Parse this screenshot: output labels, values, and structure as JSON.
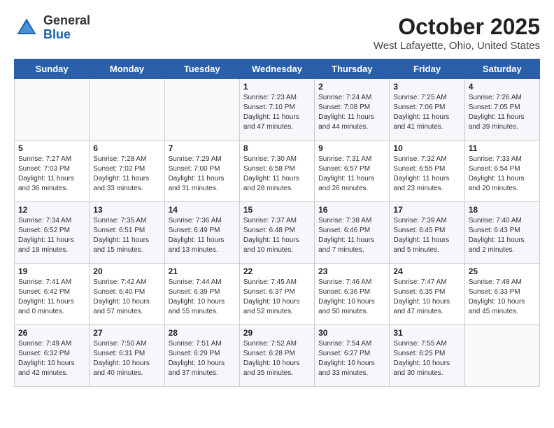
{
  "header": {
    "logo": {
      "general": "General",
      "blue": "Blue"
    },
    "title": "October 2025",
    "location": "West Lafayette, Ohio, United States"
  },
  "weekdays": [
    "Sunday",
    "Monday",
    "Tuesday",
    "Wednesday",
    "Thursday",
    "Friday",
    "Saturday"
  ],
  "weeks": [
    [
      {
        "day": "",
        "sunrise": "",
        "sunset": "",
        "daylight": ""
      },
      {
        "day": "",
        "sunrise": "",
        "sunset": "",
        "daylight": ""
      },
      {
        "day": "",
        "sunrise": "",
        "sunset": "",
        "daylight": ""
      },
      {
        "day": "1",
        "sunrise": "Sunrise: 7:23 AM",
        "sunset": "Sunset: 7:10 PM",
        "daylight": "Daylight: 11 hours and 47 minutes."
      },
      {
        "day": "2",
        "sunrise": "Sunrise: 7:24 AM",
        "sunset": "Sunset: 7:08 PM",
        "daylight": "Daylight: 11 hours and 44 minutes."
      },
      {
        "day": "3",
        "sunrise": "Sunrise: 7:25 AM",
        "sunset": "Sunset: 7:06 PM",
        "daylight": "Daylight: 11 hours and 41 minutes."
      },
      {
        "day": "4",
        "sunrise": "Sunrise: 7:26 AM",
        "sunset": "Sunset: 7:05 PM",
        "daylight": "Daylight: 11 hours and 39 minutes."
      }
    ],
    [
      {
        "day": "5",
        "sunrise": "Sunrise: 7:27 AM",
        "sunset": "Sunset: 7:03 PM",
        "daylight": "Daylight: 11 hours and 36 minutes."
      },
      {
        "day": "6",
        "sunrise": "Sunrise: 7:28 AM",
        "sunset": "Sunset: 7:02 PM",
        "daylight": "Daylight: 11 hours and 33 minutes."
      },
      {
        "day": "7",
        "sunrise": "Sunrise: 7:29 AM",
        "sunset": "Sunset: 7:00 PM",
        "daylight": "Daylight: 11 hours and 31 minutes."
      },
      {
        "day": "8",
        "sunrise": "Sunrise: 7:30 AM",
        "sunset": "Sunset: 6:58 PM",
        "daylight": "Daylight: 11 hours and 28 minutes."
      },
      {
        "day": "9",
        "sunrise": "Sunrise: 7:31 AM",
        "sunset": "Sunset: 6:57 PM",
        "daylight": "Daylight: 11 hours and 26 minutes."
      },
      {
        "day": "10",
        "sunrise": "Sunrise: 7:32 AM",
        "sunset": "Sunset: 6:55 PM",
        "daylight": "Daylight: 11 hours and 23 minutes."
      },
      {
        "day": "11",
        "sunrise": "Sunrise: 7:33 AM",
        "sunset": "Sunset: 6:54 PM",
        "daylight": "Daylight: 11 hours and 20 minutes."
      }
    ],
    [
      {
        "day": "12",
        "sunrise": "Sunrise: 7:34 AM",
        "sunset": "Sunset: 6:52 PM",
        "daylight": "Daylight: 11 hours and 18 minutes."
      },
      {
        "day": "13",
        "sunrise": "Sunrise: 7:35 AM",
        "sunset": "Sunset: 6:51 PM",
        "daylight": "Daylight: 11 hours and 15 minutes."
      },
      {
        "day": "14",
        "sunrise": "Sunrise: 7:36 AM",
        "sunset": "Sunset: 6:49 PM",
        "daylight": "Daylight: 11 hours and 13 minutes."
      },
      {
        "day": "15",
        "sunrise": "Sunrise: 7:37 AM",
        "sunset": "Sunset: 6:48 PM",
        "daylight": "Daylight: 11 hours and 10 minutes."
      },
      {
        "day": "16",
        "sunrise": "Sunrise: 7:38 AM",
        "sunset": "Sunset: 6:46 PM",
        "daylight": "Daylight: 11 hours and 7 minutes."
      },
      {
        "day": "17",
        "sunrise": "Sunrise: 7:39 AM",
        "sunset": "Sunset: 6:45 PM",
        "daylight": "Daylight: 11 hours and 5 minutes."
      },
      {
        "day": "18",
        "sunrise": "Sunrise: 7:40 AM",
        "sunset": "Sunset: 6:43 PM",
        "daylight": "Daylight: 11 hours and 2 minutes."
      }
    ],
    [
      {
        "day": "19",
        "sunrise": "Sunrise: 7:41 AM",
        "sunset": "Sunset: 6:42 PM",
        "daylight": "Daylight: 11 hours and 0 minutes."
      },
      {
        "day": "20",
        "sunrise": "Sunrise: 7:42 AM",
        "sunset": "Sunset: 6:40 PM",
        "daylight": "Daylight: 10 hours and 57 minutes."
      },
      {
        "day": "21",
        "sunrise": "Sunrise: 7:44 AM",
        "sunset": "Sunset: 6:39 PM",
        "daylight": "Daylight: 10 hours and 55 minutes."
      },
      {
        "day": "22",
        "sunrise": "Sunrise: 7:45 AM",
        "sunset": "Sunset: 6:37 PM",
        "daylight": "Daylight: 10 hours and 52 minutes."
      },
      {
        "day": "23",
        "sunrise": "Sunrise: 7:46 AM",
        "sunset": "Sunset: 6:36 PM",
        "daylight": "Daylight: 10 hours and 50 minutes."
      },
      {
        "day": "24",
        "sunrise": "Sunrise: 7:47 AM",
        "sunset": "Sunset: 6:35 PM",
        "daylight": "Daylight: 10 hours and 47 minutes."
      },
      {
        "day": "25",
        "sunrise": "Sunrise: 7:48 AM",
        "sunset": "Sunset: 6:33 PM",
        "daylight": "Daylight: 10 hours and 45 minutes."
      }
    ],
    [
      {
        "day": "26",
        "sunrise": "Sunrise: 7:49 AM",
        "sunset": "Sunset: 6:32 PM",
        "daylight": "Daylight: 10 hours and 42 minutes."
      },
      {
        "day": "27",
        "sunrise": "Sunrise: 7:50 AM",
        "sunset": "Sunset: 6:31 PM",
        "daylight": "Daylight: 10 hours and 40 minutes."
      },
      {
        "day": "28",
        "sunrise": "Sunrise: 7:51 AM",
        "sunset": "Sunset: 6:29 PM",
        "daylight": "Daylight: 10 hours and 37 minutes."
      },
      {
        "day": "29",
        "sunrise": "Sunrise: 7:52 AM",
        "sunset": "Sunset: 6:28 PM",
        "daylight": "Daylight: 10 hours and 35 minutes."
      },
      {
        "day": "30",
        "sunrise": "Sunrise: 7:54 AM",
        "sunset": "Sunset: 6:27 PM",
        "daylight": "Daylight: 10 hours and 33 minutes."
      },
      {
        "day": "31",
        "sunrise": "Sunrise: 7:55 AM",
        "sunset": "Sunset: 6:25 PM",
        "daylight": "Daylight: 10 hours and 30 minutes."
      },
      {
        "day": "",
        "sunrise": "",
        "sunset": "",
        "daylight": ""
      }
    ]
  ]
}
